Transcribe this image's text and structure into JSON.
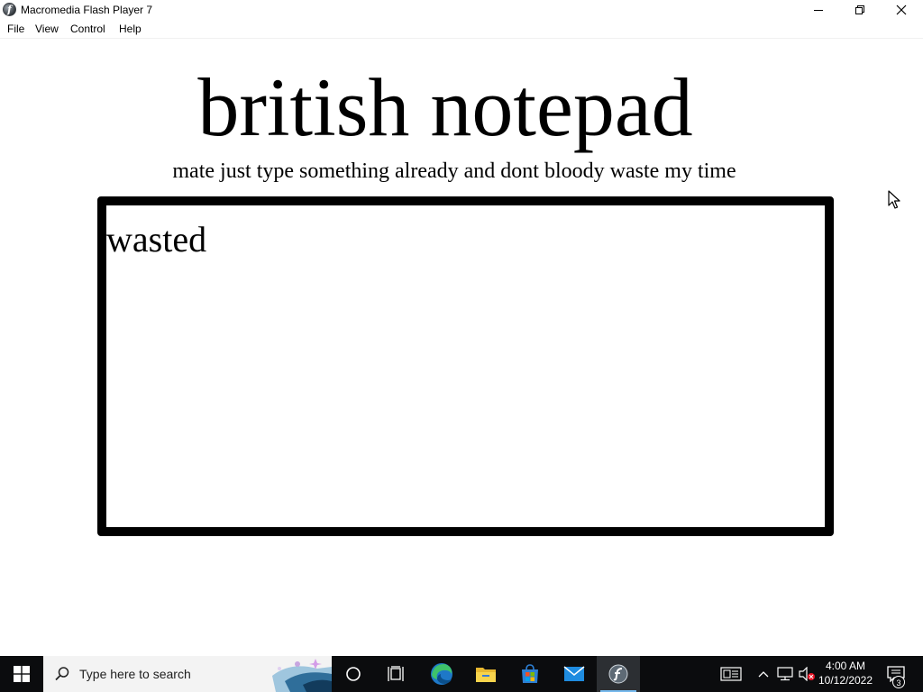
{
  "window": {
    "title": "Macromedia Flash Player 7",
    "icon": "flash-player-icon"
  },
  "menu": {
    "items": [
      {
        "label": "File"
      },
      {
        "label": "View"
      },
      {
        "label": "Control"
      },
      {
        "label": "Help"
      }
    ]
  },
  "content": {
    "title": "british notepad",
    "subtitle": "mate just type something already and dont bloody waste my time",
    "note_text": "wasted"
  },
  "taskbar": {
    "search_placeholder": "Type here to search",
    "pinned": [
      {
        "name": "cortana-icon"
      },
      {
        "name": "task-view-icon"
      },
      {
        "name": "edge-icon"
      },
      {
        "name": "file-explorer-icon"
      },
      {
        "name": "microsoft-store-icon"
      },
      {
        "name": "mail-icon"
      },
      {
        "name": "flash-player-icon",
        "active": true
      }
    ],
    "clock": {
      "time": "4:00 AM",
      "date": "10/12/2022"
    },
    "notifications_count": "3"
  },
  "colors": {
    "taskbar": "#0b0c0e",
    "accent": "#76b9ed",
    "note_border": "#000000"
  }
}
